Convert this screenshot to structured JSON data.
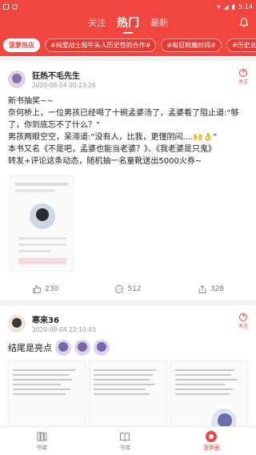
{
  "status": {
    "time": "5:14"
  },
  "header": {
    "tabs": [
      {
        "label": "关注"
      },
      {
        "label": "热门"
      },
      {
        "label": "最新"
      }
    ]
  },
  "tags": [
    {
      "label": "菠萝热店"
    },
    {
      "label": "#纯爱战士和牛头人历史性的合作#"
    },
    {
      "label": "#每日附魔时间#"
    },
    {
      "label": "#历史总是"
    }
  ],
  "post1": {
    "user": "狂热不毛先生",
    "time": "2020-08-04 00:23:26",
    "follow": "关注",
    "lines": [
      "新书抽奖~~",
      "",
      "奈何桥上，一位男孩已经喝了十碗孟婆汤了，孟婆看了阻止道:“够",
      "了，你到底忘不了什么？”",
      "男孩两眼空空，呆滞道:“没有人，比我，更懂阴间....🙌👌”",
      "",
      "本书又名《不是吧，孟婆也能当老婆？》、《我老婆是只鬼》",
      "转发+评论这条动态，随机抽一名童靴送出5000火券~"
    ],
    "likes": "230",
    "comments": "512",
    "shares": "328"
  },
  "post2": {
    "user": "寒来36",
    "time": "2020-08-04 22:10:43",
    "follow": "关注",
    "title": "结尾是亮点"
  },
  "bottom_nav": [
    {
      "label": "书架"
    },
    {
      "label": "书库"
    },
    {
      "label": "菠萝圈"
    }
  ],
  "colors": {
    "accent": "#f0463f"
  }
}
